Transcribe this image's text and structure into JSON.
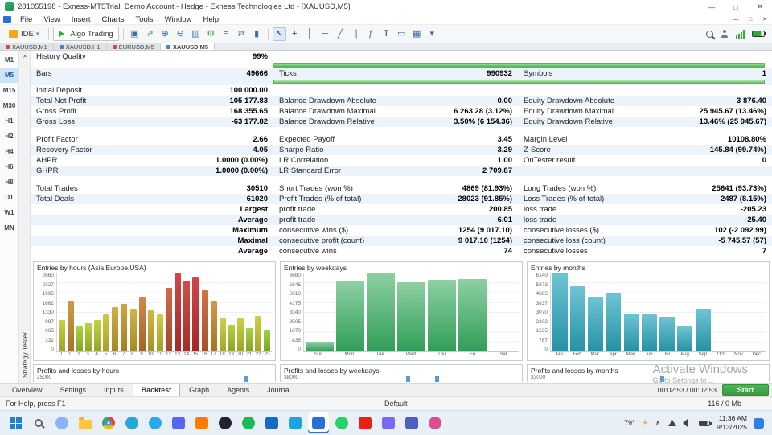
{
  "titlebar": {
    "title": "281055198 - Exness-MT5Trial: Demo Account - Hedge - Exness Technologies Ltd - [XAUUSD,M5]",
    "buttons": {
      "minimize": "—",
      "maximize": "□",
      "close": "✕"
    }
  },
  "menubar": {
    "items": [
      "File",
      "View",
      "Insert",
      "Charts",
      "Tools",
      "Window",
      "Help"
    ]
  },
  "toolbar": {
    "ide_label": "IDE",
    "algo_label": "Algo Trading",
    "items": [
      {
        "t": "ide"
      },
      {
        "t": "sep"
      },
      {
        "t": "algo"
      },
      {
        "t": "sep"
      },
      {
        "t": "icon",
        "name": "new-order-icon",
        "g": "▣",
        "c": "#3a6ea5"
      },
      {
        "t": "icon",
        "name": "tick-chart-icon",
        "g": "⇗",
        "c": "#2e9e4f"
      },
      {
        "t": "icon",
        "name": "zoom-in-icon",
        "g": "⊕",
        "c": "#3a6ea5"
      },
      {
        "t": "icon",
        "name": "zoom-out-icon",
        "g": "⊖",
        "c": "#3a6ea5"
      },
      {
        "t": "icon",
        "name": "chart-mode-icon",
        "g": "▥",
        "c": "#3a6ea5"
      },
      {
        "t": "icon",
        "name": "expert-settings-icon",
        "g": "⚙",
        "c": "#2e9e4f"
      },
      {
        "t": "icon",
        "name": "market-watch-icon",
        "g": "≡",
        "c": "#2e9e4f"
      },
      {
        "t": "icon",
        "name": "chart-shift-icon",
        "g": "⇄",
        "c": "#3a6ea5"
      },
      {
        "t": "icon",
        "name": "bar-style-icon",
        "g": "▮",
        "c": "#3a6ea5"
      },
      {
        "t": "sep"
      },
      {
        "t": "icon",
        "name": "cursor-icon",
        "g": "↖",
        "c": "#333",
        "active": true
      },
      {
        "t": "icon",
        "name": "crosshair-icon",
        "g": "+",
        "c": "#333"
      },
      {
        "t": "icon",
        "name": "vertical-line-icon",
        "g": "│",
        "c": "#3a6ea5"
      },
      {
        "t": "icon",
        "name": "horizontal-line-icon",
        "g": "─",
        "c": "#3a6ea5"
      },
      {
        "t": "icon",
        "name": "trendline-icon",
        "g": "╱",
        "c": "#3a6ea5"
      },
      {
        "t": "icon",
        "name": "channel-icon",
        "g": "∥",
        "c": "#3a6ea5"
      },
      {
        "t": "icon",
        "name": "fibonacci-icon",
        "g": "ƒ",
        "c": "#3a6ea5"
      },
      {
        "t": "icon",
        "name": "text-label-icon",
        "g": "T",
        "c": "#333"
      },
      {
        "t": "icon",
        "name": "shapes-icon",
        "g": "▭",
        "c": "#3a6ea5"
      },
      {
        "t": "icon",
        "name": "arrange-windows-icon",
        "g": "▦",
        "c": "#3a6ea5"
      },
      {
        "t": "icon",
        "name": "objects-dropdown-icon",
        "g": "▾",
        "c": "#666"
      }
    ]
  },
  "chart_tabs": {
    "items": [
      {
        "label": "XAUUSD,M1",
        "icon_color": "#c0504d"
      },
      {
        "label": "XAUUSD,H1",
        "icon_color": "#4f81bd"
      },
      {
        "label": "EURUSD,M5",
        "icon_color": "#c0504d"
      },
      {
        "label": "XAUUSD,M5",
        "icon_color": "#4f81bd",
        "active": true
      }
    ]
  },
  "timeframes": {
    "items": [
      "M1",
      "M5",
      "M15",
      "M30",
      "H1",
      "H2",
      "H4",
      "H6",
      "H8",
      "D1",
      "W1",
      "MN"
    ],
    "active": "M5"
  },
  "tester_panel": {
    "close_glyph": "✕",
    "vertical_label": "Strategy Tester"
  },
  "report": {
    "rows": [
      {
        "t": "text",
        "c": [
          "History Quality",
          "99%",
          "",
          "",
          "",
          ""
        ]
      },
      {
        "t": "bar"
      },
      {
        "t": "text",
        "c": [
          "Bars",
          "49666",
          "Ticks",
          "990932",
          "Symbols",
          "1"
        ]
      },
      {
        "t": "bar"
      },
      {
        "t": "text",
        "c": [
          "Initial Deposit",
          "100 000.00",
          "",
          "",
          "",
          ""
        ]
      },
      {
        "t": "text",
        "c": [
          "Total Net Profit",
          "105 177.83",
          "Balance Drawdown Absolute",
          "0.00",
          "Equity Drawdown Absolute",
          "3 876.40"
        ]
      },
      {
        "t": "text",
        "c": [
          "Gross Profit",
          "168 355.65",
          "Balance Drawdown Maximal",
          "6 263.28 (3.12%)",
          "Equity Drawdown Maximal",
          "25 945.67 (13.46%)"
        ]
      },
      {
        "t": "text",
        "c": [
          "Gross Loss",
          "-63 177.82",
          "Balance Drawdown Relative",
          "3.50% (6 154.36)",
          "Equity Drawdown Relative",
          "13.46% (25 945.67)"
        ]
      },
      {
        "t": "gap"
      },
      {
        "t": "text",
        "c": [
          "Profit Factor",
          "2.66",
          "Expected Payoff",
          "3.45",
          "Margin Level",
          "10108.80%"
        ]
      },
      {
        "t": "text",
        "c": [
          "Recovery Factor",
          "4.05",
          "Sharpe Ratio",
          "3.29",
          "Z-Score",
          "-145.84 (99.74%)"
        ]
      },
      {
        "t": "text",
        "c": [
          "AHPR",
          "1.0000 (0.00%)",
          "LR Correlation",
          "1.00",
          "OnTester result",
          "0"
        ]
      },
      {
        "t": "text",
        "c": [
          "GHPR",
          "1.0000 (0.00%)",
          "LR Standard Error",
          "2 709.87",
          "",
          ""
        ]
      },
      {
        "t": "gap"
      },
      {
        "t": "text",
        "c": [
          "Total Trades",
          "30510",
          "Short Trades (won %)",
          "4869 (81.93%)",
          "Long Trades (won %)",
          "25641 (93.73%)"
        ]
      },
      {
        "t": "text",
        "c": [
          "Total Deals",
          "61020",
          "Profit Trades (% of total)",
          "28023 (91.85%)",
          "Loss Trades (% of total)",
          "2487 (8.15%)"
        ]
      },
      {
        "t": "text",
        "c": [
          "",
          "Largest",
          "profit trade",
          "200.85",
          "loss trade",
          "-205.23"
        ]
      },
      {
        "t": "text",
        "c": [
          "",
          "Average",
          "profit trade",
          "6.01",
          "loss trade",
          "-25.40"
        ]
      },
      {
        "t": "text",
        "c": [
          "",
          "Maximum",
          "consecutive wins ($)",
          "1254 (9 017.10)",
          "consecutive losses ($)",
          "102 (-2 092.99)"
        ]
      },
      {
        "t": "text",
        "c": [
          "",
          "Maximal",
          "consecutive profit (count)",
          "9 017.10 (1254)",
          "consecutive loss (count)",
          "-5 745.57 (57)"
        ]
      },
      {
        "t": "text",
        "c": [
          "",
          "Average",
          "consecutive wins",
          "74",
          "consecutive losses",
          "7"
        ]
      }
    ]
  },
  "chart_data": [
    {
      "type": "bar",
      "name": "entries-by-hours-chart",
      "title": "Entries by hours (Asia,Europe,USA)",
      "categories": [
        "0",
        "1",
        "2",
        "3",
        "4",
        "5",
        "6",
        "7",
        "8",
        "9",
        "10",
        "11",
        "12",
        "13",
        "14",
        "15",
        "16",
        "17",
        "18",
        "19",
        "20",
        "21",
        "22",
        "23"
      ],
      "values": [
        1050,
        1700,
        850,
        950,
        1060,
        1250,
        1500,
        1600,
        1450,
        1850,
        1400,
        1250,
        2150,
        2660,
        2400,
        2500,
        2050,
        1700,
        1150,
        900,
        1100,
        800,
        1200,
        700
      ],
      "ylim": [
        0,
        2660
      ],
      "yticks": [
        2660,
        2327,
        1995,
        1662,
        1330,
        997,
        665,
        332,
        0
      ],
      "palette": "heat",
      "xlabel": "",
      "ylabel": ""
    },
    {
      "type": "bar",
      "name": "entries-by-weekdays-chart",
      "title": "Entries by weekdays",
      "categories": [
        "Sun",
        "Mon",
        "Tue",
        "Wed",
        "Thu",
        "Fri",
        "Sat"
      ],
      "values": [
        835,
        5900,
        6680,
        5850,
        6100,
        6150,
        0
      ],
      "ylim": [
        0,
        6680
      ],
      "yticks": [
        6680,
        5845,
        5010,
        4175,
        3340,
        2505,
        1670,
        835,
        0
      ],
      "palette": "green",
      "xlabel": "",
      "ylabel": ""
    },
    {
      "type": "bar",
      "name": "entries-by-months-chart",
      "title": "Entries by months",
      "categories": [
        "Jan",
        "Feb",
        "Mar",
        "Apr",
        "May",
        "Jun",
        "Jul",
        "Aug",
        "Sep",
        "Oct",
        "Nov",
        "Dec"
      ],
      "values": [
        6140,
        5050,
        4250,
        4550,
        2950,
        2900,
        2700,
        1950,
        3300,
        0,
        0,
        0
      ],
      "ylim": [
        0,
        6140
      ],
      "yticks": [
        6140,
        5373,
        4605,
        3837,
        3070,
        2302,
        1535,
        767,
        0
      ],
      "palette": "teal",
      "xlabel": "",
      "ylabel": ""
    }
  ],
  "partial_charts": [
    {
      "name": "profits-by-hours-chart",
      "title": "Profits and losses by hours",
      "top_tick": "25000",
      "stubs": [
        0.87
      ]
    },
    {
      "name": "profits-by-weekdays-chart",
      "title": "Profits and losses by weekdays",
      "top_tick": "38000",
      "stubs": [
        0.52,
        0.64
      ]
    },
    {
      "name": "profits-by-months-chart",
      "title": "Profits and losses by months",
      "top_tick": "33000",
      "stubs": [
        0.55
      ]
    }
  ],
  "tester_tabs": {
    "items": [
      "Overview",
      "Settings",
      "Inputs",
      "Backtest",
      "Graph",
      "Agents",
      "Journal"
    ],
    "active": "Backtest",
    "timer": "00:02:53 / 00:02:53",
    "start_label": "Start"
  },
  "statusbar": {
    "help": "For Help, press F1",
    "profile": "Default",
    "memory": "116 / 0 Mb"
  },
  "watermark": {
    "line1": "Activate Windows",
    "line2": "Go to Settings to ..."
  },
  "taskbar": {
    "icons": [
      {
        "name": "start-button",
        "shape": "winlogo",
        "color": "#1f7fd4"
      },
      {
        "name": "search-button",
        "shape": "magnifier",
        "color": "#5f6368"
      },
      {
        "name": "copilot-icon",
        "shape": "circle",
        "color": "#8ab4f8"
      },
      {
        "name": "file-explorer-icon",
        "shape": "folder",
        "color": "#ffc63e"
      },
      {
        "name": "chrome-icon",
        "shape": "chrome",
        "color": "#ea4335"
      },
      {
        "name": "edge-icon",
        "shape": "circle",
        "color": "#2aa7d8"
      },
      {
        "name": "telegram-icon",
        "shape": "circle",
        "color": "#29a9eb"
      },
      {
        "name": "discord-icon",
        "shape": "square",
        "color": "#5865f2"
      },
      {
        "name": "vlc-icon",
        "shape": "square",
        "color": "#ff7a00"
      },
      {
        "name": "obs-icon",
        "shape": "circle",
        "color": "#1f2430"
      },
      {
        "name": "spotify-icon",
        "shape": "circle",
        "color": "#1db954"
      },
      {
        "name": "tv-app-icon",
        "shape": "square",
        "color": "#1769c7"
      },
      {
        "name": "store-icon",
        "shape": "square",
        "color": "#21a2e0"
      },
      {
        "name": "mt5-icon",
        "shape": "square",
        "color": "#2a6fd4",
        "active": true
      },
      {
        "name": "whatsapp-icon",
        "shape": "circle",
        "color": "#25d366"
      },
      {
        "name": "youtube-icon",
        "shape": "square",
        "color": "#e62117"
      },
      {
        "name": "camera-icon",
        "shape": "square",
        "color": "#7b68ee"
      },
      {
        "name": "teams-icon",
        "shape": "square",
        "color": "#4e5fbf"
      },
      {
        "name": "photos-icon",
        "shape": "circle",
        "color": "#d94f90"
      }
    ],
    "tray_icons": [
      "network-icon",
      "speaker-icon",
      "battery-icon"
    ],
    "temp": "79°",
    "weather_glyph": "☀",
    "chevron_glyph": "∧",
    "time": "11:36 AM",
    "date": "9/13/2025"
  }
}
